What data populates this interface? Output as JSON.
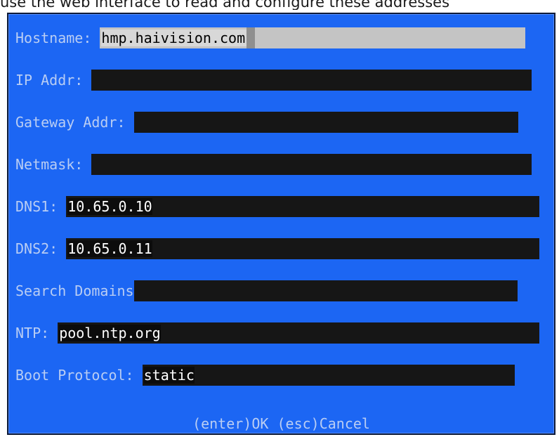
{
  "caption": "use the web interface to read and configure these addresses",
  "fields": [
    {
      "label": "Hostname: ",
      "value": "hmp.haivision.com"
    },
    {
      "label": "IP Addr: ",
      "value": ""
    },
    {
      "label": "Gateway Addr: ",
      "value": ""
    },
    {
      "label": "Netmask: ",
      "value": ""
    },
    {
      "label": "DNS1: ",
      "value": "10.65.0.10"
    },
    {
      "label": "DNS2: ",
      "value": "10.65.0.11"
    },
    {
      "label": "Search Domains",
      "value": ""
    },
    {
      "label": "NTP: ",
      "value": "pool.ntp.org"
    },
    {
      "label": "Boot Protocol: ",
      "value": "static"
    }
  ],
  "footer": {
    "ok": "(enter)OK",
    "cancel": "(esc)Cancel"
  },
  "colors": {
    "dialog_bg": "#1c66f3",
    "label": "#b9cdf3",
    "field_bg": "#161616",
    "active_field_bg": "#c4c4c4"
  }
}
